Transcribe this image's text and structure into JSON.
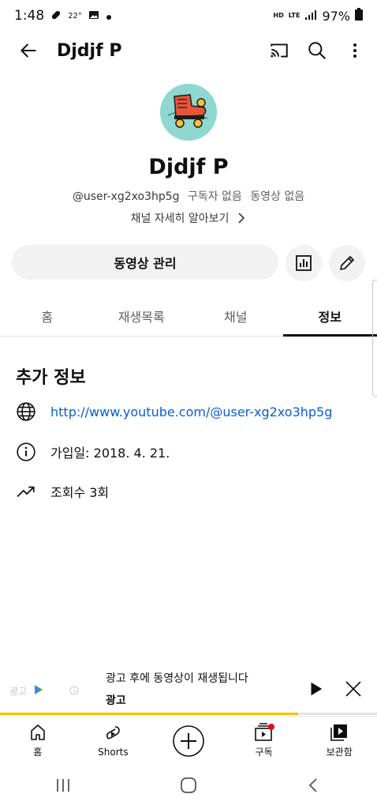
{
  "status_bar": {
    "time": "1:48",
    "temperature": "22°",
    "network_labels": [
      "HD",
      "LTE"
    ],
    "battery": "97%"
  },
  "header": {
    "title": "Djdjf P",
    "back_icon": "arrow-left-icon",
    "cast_icon": "cast-icon",
    "search_icon": "search-icon",
    "more_icon": "more-vert-icon"
  },
  "channel": {
    "name": "Djdjf P",
    "handle": "@user-xg2xo3hp5g",
    "subscribers": "구독자 없음",
    "videos": "동영상 없음",
    "about_link": "채널 자세히 알아보기",
    "avatar_color": "#8fd8d0"
  },
  "actions": {
    "manage_videos": "동영상 관리",
    "analytics_icon": "analytics-icon",
    "edit_icon": "edit-pencil-icon"
  },
  "tabs": [
    {
      "label": "홈",
      "active": false
    },
    {
      "label": "재생목록",
      "active": false
    },
    {
      "label": "채널",
      "active": false
    },
    {
      "label": "정보",
      "active": true
    }
  ],
  "about": {
    "section_title": "추가 정보",
    "link": "http://www.youtube.com/@user-xg2xo3hp5g",
    "joined": "가입일: 2018. 4. 21.",
    "views": "조회수 3회"
  },
  "ad": {
    "thumb_label": "광고",
    "line1": "광고 후에 동영상이 재생됩니다",
    "line2": "광고",
    "progress": 0.79,
    "accent_color": "#f2c200"
  },
  "bottom_nav": [
    {
      "label": "홈",
      "icon": "home-icon"
    },
    {
      "label": "Shorts",
      "icon": "shorts-icon"
    },
    {
      "label": "",
      "icon": "create-plus-icon"
    },
    {
      "label": "구독",
      "icon": "subscriptions-icon"
    },
    {
      "label": "보관함",
      "icon": "library-icon"
    }
  ],
  "colors": {
    "link": "#065fd4",
    "notification_dot": "#e50914",
    "text_secondary": "#606060"
  }
}
